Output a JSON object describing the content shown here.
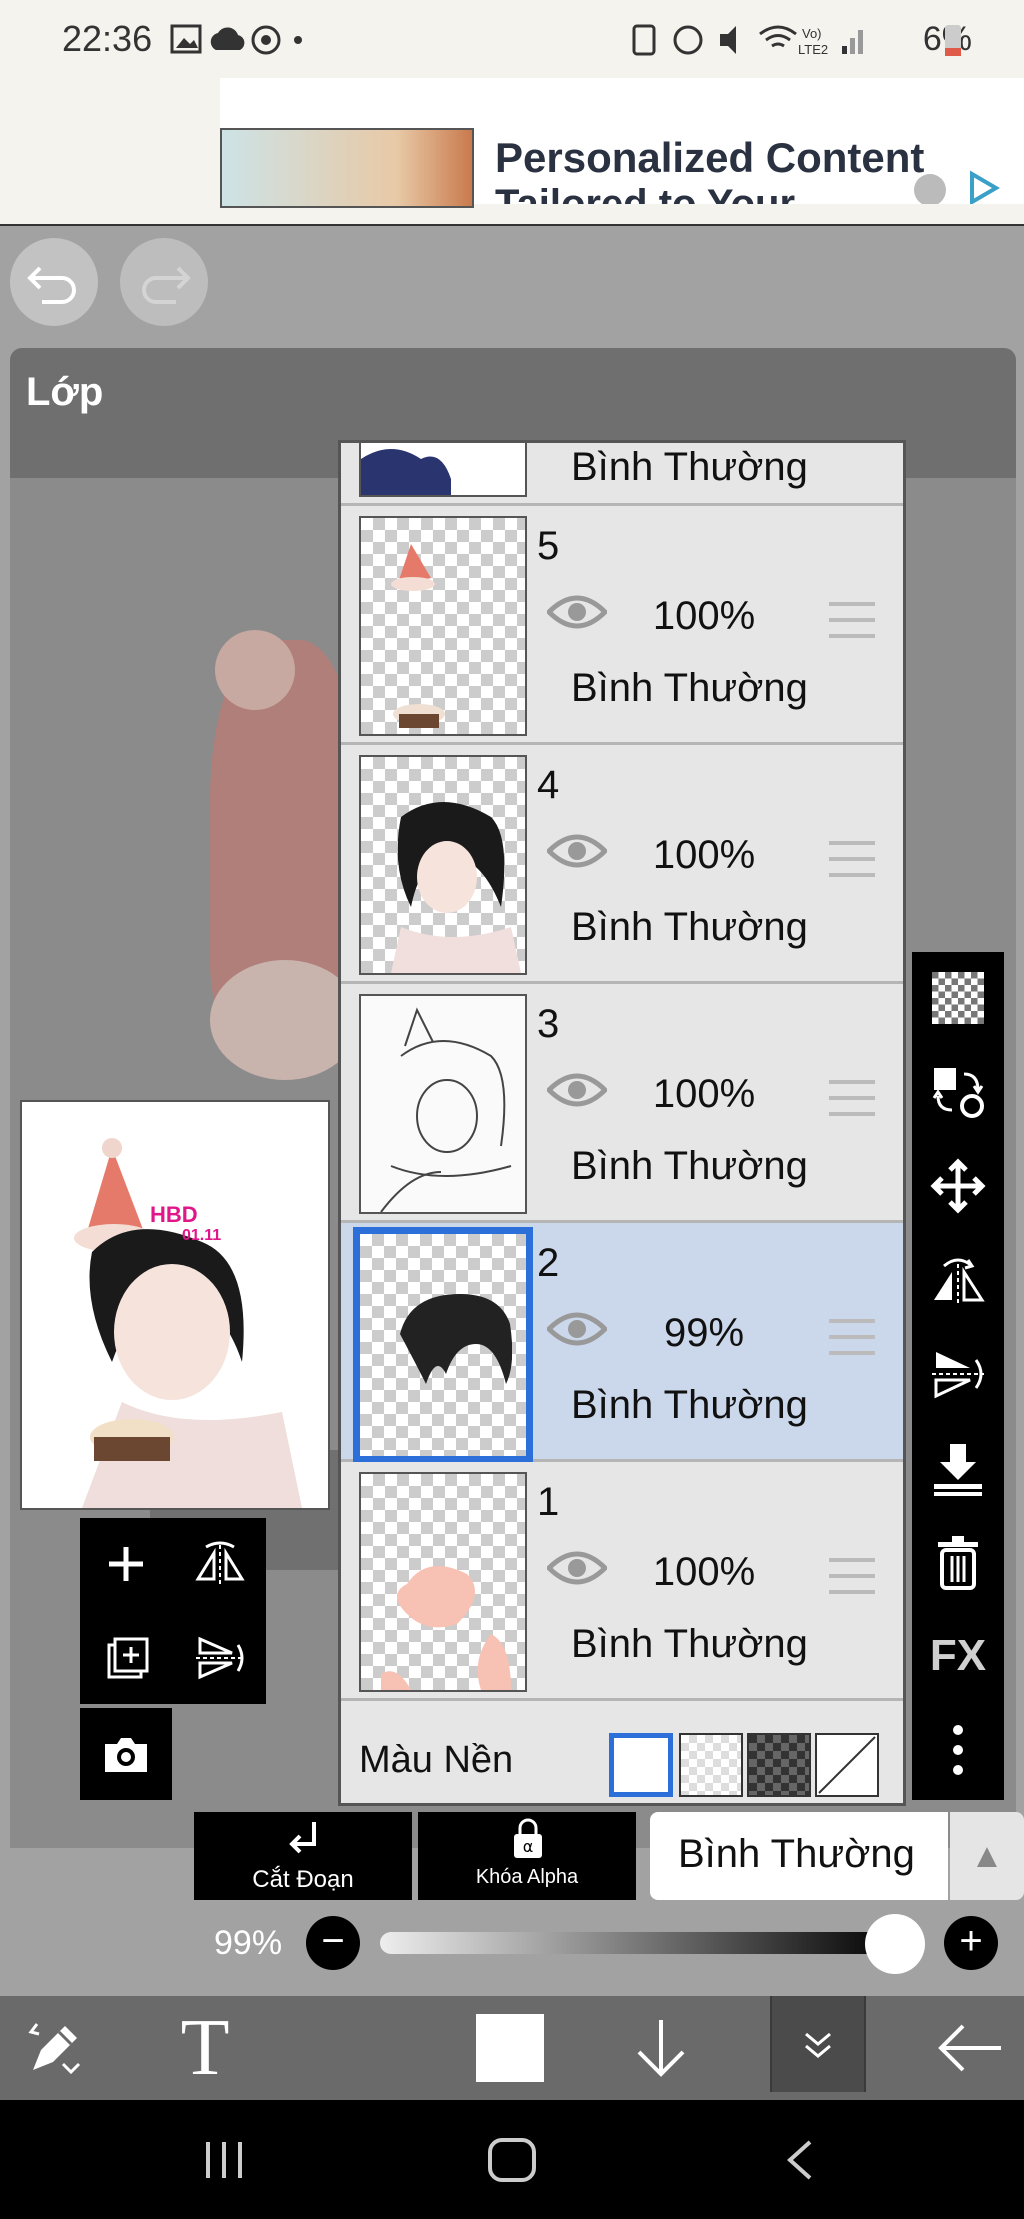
{
  "status_bar": {
    "time": "22:36",
    "battery": "6%"
  },
  "ad": {
    "headline": "Personalized Content",
    "subtext": "Tailored to Your"
  },
  "panel": {
    "title": "Lớp"
  },
  "layers": [
    {
      "number": "",
      "opacity": "",
      "blend": "Bình Thường"
    },
    {
      "number": "5",
      "opacity": "100%",
      "blend": "Bình Thường"
    },
    {
      "number": "4",
      "opacity": "100%",
      "blend": "Bình Thường"
    },
    {
      "number": "3",
      "opacity": "100%",
      "blend": "Bình Thường"
    },
    {
      "number": "2",
      "opacity": "99%",
      "blend": "Bình Thường",
      "selected": true
    },
    {
      "number": "1",
      "opacity": "100%",
      "blend": "Bình Thường"
    }
  ],
  "background": {
    "label": "Màu Nền"
  },
  "preview": {
    "text1": "HBD",
    "text2": "01.11"
  },
  "bottom_controls": {
    "clip_label": "Cắt Đoạn",
    "alpha_label": "Khóa Alpha",
    "blend_mode": "Bình Thường",
    "opacity_value": "99%"
  },
  "opacity_slider": {
    "value": 0.99
  },
  "right_toolbar": {
    "fx_label": "FX"
  },
  "bottom_toolbar": {
    "text_tool_label": "T"
  },
  "colors": {
    "accent": "#2d6fd8",
    "selected_row": "#cbd8ec",
    "panel_bg": "#e6e6e6"
  }
}
